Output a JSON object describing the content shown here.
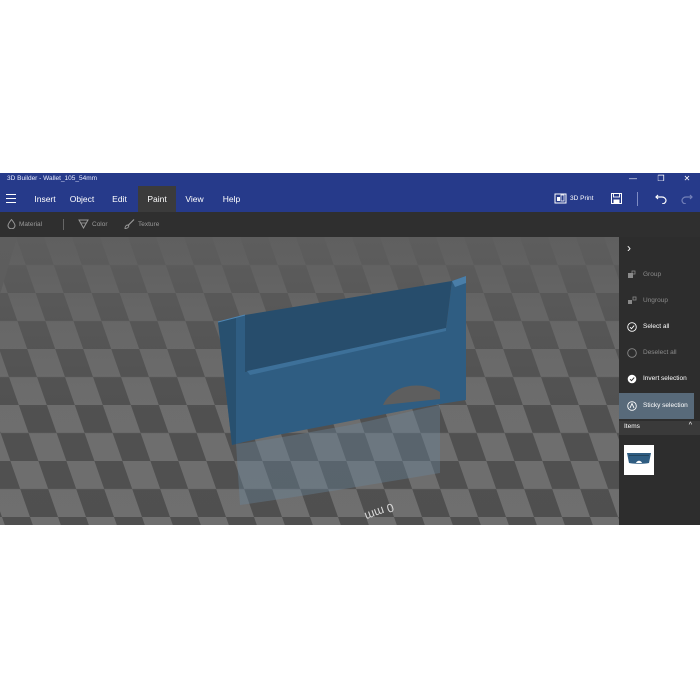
{
  "window": {
    "title": "3D Builder - Wallet_105_54mm",
    "minimize_glyph": "—",
    "restore_glyph": "❐",
    "close_glyph": "✕"
  },
  "menu": {
    "items": [
      {
        "label": "Insert"
      },
      {
        "label": "Object"
      },
      {
        "label": "Edit"
      },
      {
        "label": "Paint",
        "active": true
      },
      {
        "label": "View"
      },
      {
        "label": "Help"
      }
    ],
    "print_label": "3D Print"
  },
  "paint_toolbar": {
    "material_label": "Material",
    "color_label": "Color",
    "texture_label": "Texture"
  },
  "viewport": {
    "ruler_label": "0 mm",
    "checker_light": "#6f6f6f",
    "checker_dark": "#4f4f4f",
    "model_color": "#2f5d82"
  },
  "side_panel": {
    "collapse_glyph": "›",
    "actions": [
      {
        "label": "Group",
        "state": "disabled",
        "icon": "group-icon"
      },
      {
        "label": "Ungroup",
        "state": "disabled",
        "icon": "ungroup-icon"
      },
      {
        "label": "Select all",
        "state": "enabled",
        "icon": "select-all-icon"
      },
      {
        "label": "Deselect all",
        "state": "disabled",
        "icon": "deselect-all-icon"
      },
      {
        "label": "Invert selection",
        "state": "enabled",
        "icon": "invert-selection-icon"
      },
      {
        "label": "Sticky selection",
        "state": "highlight",
        "icon": "sticky-selection-icon"
      }
    ],
    "items_header": "Items",
    "items_chevron": "^"
  },
  "colors": {
    "titlebar": "#263a8a",
    "active_tab": "#3b3b3b",
    "highlight": "#586a7a"
  }
}
